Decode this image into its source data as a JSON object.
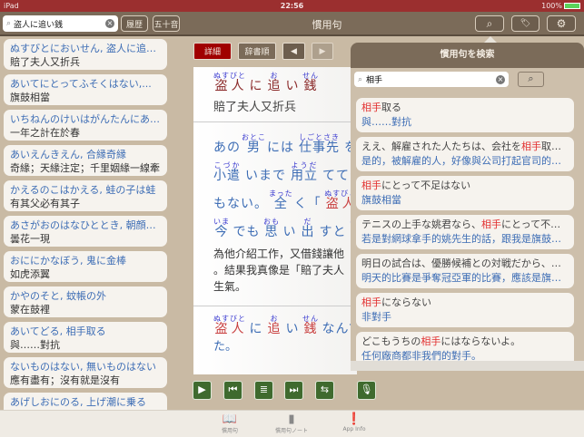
{
  "status": {
    "device": "iPad",
    "time": "22:56",
    "battery": "100%"
  },
  "nav": {
    "search_value": "盗人に追い銭",
    "history": "履歴",
    "gojuon": "五十音",
    "title": "慣用句"
  },
  "list": [
    {
      "j": "ぬすびとにおいせん, 盗人に追…",
      "c": "賠了夫人又折兵"
    },
    {
      "j": "あいてにとってふそくはない,...",
      "c": "旗鼓相當"
    },
    {
      "j": "いちねんのけいはがんたんにあ…",
      "c": "一年之計在於春"
    },
    {
      "j": "あいえんきえん, 合縁奇縁",
      "c": "奇緣；天緣注定；千里姻緣一線牽"
    },
    {
      "j": "かえるのこはかえる, 蛙の子は蛙",
      "c": "有其父必有其子"
    },
    {
      "j": "あさがおのはなひととき, 朝顔…",
      "c": "曇花一現"
    },
    {
      "j": "おににかなぼう, 鬼に金棒",
      "c": "如虎添翼"
    },
    {
      "j": "かやのそと, 蚊帳の外",
      "c": "蒙在鼓裡"
    },
    {
      "j": "あいてどる, 相手取る",
      "c": "與……對抗"
    },
    {
      "j": "ないものはない, 無いものはない",
      "c": "應有盡有；沒有就是沒有"
    },
    {
      "j": "あげしおにのる, 上げ潮に乗る",
      "c": ""
    }
  ],
  "detail": {
    "tab_detail": "詳細",
    "tab_dict": "辞書順",
    "headword": [
      {
        "t": "盗人",
        "r": "ぬすびと",
        "c": "#8b2a2a"
      },
      {
        "t": "に",
        "c": "#8b2a2a"
      },
      {
        "t": "追",
        "r": "お",
        "c": "#8b2a2a"
      },
      {
        "t": "い",
        "c": "#8b2a2a"
      },
      {
        "t": "銭",
        "r": "せん",
        "c": "#8b2a2a"
      }
    ],
    "meaning": "賠了夫人又折兵",
    "example": [
      [
        {
          "t": "あの",
          "c": "#3d6db5"
        },
        {
          "t": "男",
          "r": "おとこ",
          "c": "#3d6db5"
        },
        {
          "t": "には",
          "c": "#3d6db5"
        },
        {
          "t": "仕事先",
          "r": "しごとさき",
          "c": "#3d6db5"
        },
        {
          "t": "を",
          "c": "#3d6db5"
        }
      ],
      [
        {
          "t": "小遣",
          "r": "こづか",
          "c": "#3d6db5"
        },
        {
          "t": "いまで",
          "c": "#3d6db5"
        },
        {
          "t": "用立",
          "r": "ようだ",
          "c": "#3d6db5"
        },
        {
          "t": "ててや",
          "c": "#3d6db5"
        }
      ],
      [
        {
          "t": "もない。",
          "c": "#3d6db5"
        },
        {
          "t": "全",
          "r": "まった",
          "c": "#3d6db5"
        },
        {
          "t": "く「",
          "c": "#3d6db5"
        },
        {
          "t": "盗人",
          "r": "ぬすびと",
          "c": "#c94040"
        }
      ],
      [
        {
          "t": "今",
          "r": "いま",
          "c": "#3d6db5"
        },
        {
          "t": "でも",
          "c": "#3d6db5"
        },
        {
          "t": "思",
          "r": "おも",
          "c": "#3d6db5"
        },
        {
          "t": "い",
          "c": "#3d6db5"
        },
        {
          "t": "出",
          "r": "だ",
          "c": "#3d6db5"
        },
        {
          "t": "すと",
          "c": "#3d6db5"
        },
        {
          "t": "腹",
          "r": "はら",
          "c": "#3d6db5"
        }
      ]
    ],
    "translation": [
      "為他介紹工作，又借錢讓他",
      "。結果我真像是「賠了夫人",
      "生氣。"
    ],
    "example2": [
      {
        "t": "盗人",
        "r": "ぬすびと",
        "c": "#c94040"
      },
      {
        "t": "に",
        "c": "#3d6db5"
      },
      {
        "t": "追",
        "r": "お",
        "c": "#c94040"
      },
      {
        "t": "い",
        "c": "#3d6db5"
      },
      {
        "t": "銭",
        "r": "せん",
        "c": "#c94040"
      },
      {
        "t": "なんて",
        "c": "#3d6db5"
      }
    ],
    "example2_tail": "た。"
  },
  "popover": {
    "title": "慣用句を検索",
    "search_value": "相手",
    "highlight": "相手",
    "results": [
      {
        "a": "相手取る",
        "b": "與……對抗"
      },
      {
        "a": "ええ、解雇された人たちは、会社を相手取っ…",
        "b": "是的，被解雇的人，好像與公司打起官司的樣…"
      },
      {
        "a": "相手にとって不足はない",
        "b": "旗鼓相當"
      },
      {
        "a": "テニスの上手な姚君なら、相手にとって不足…",
        "b": "若是對網球拿手的姚先生的話，跟我是旗鼓相…"
      },
      {
        "a": "明日の試合は、優勝候補との対戦だから、相…",
        "b": "明天的比賽是爭奪冠亞軍的比賽，應該是旗鼓…"
      },
      {
        "a": "相手にならない",
        "b": "非對手"
      },
      {
        "a": "どこもうちの相手にはならないよ。",
        "b": "任何廠商都非我們的對手。"
      }
    ]
  },
  "tabs": [
    {
      "label": "慣用句",
      "icon": "book-icon"
    },
    {
      "label": "慣用句ノート",
      "icon": "notebook-icon"
    },
    {
      "label": "App Info",
      "icon": "info-icon"
    }
  ],
  "colors": {
    "status_bar": "#9b2f2f",
    "nav": "#7b6b59",
    "active_tab": "#a00000",
    "control": "#3f6a2e",
    "highlight": "#e23030"
  }
}
